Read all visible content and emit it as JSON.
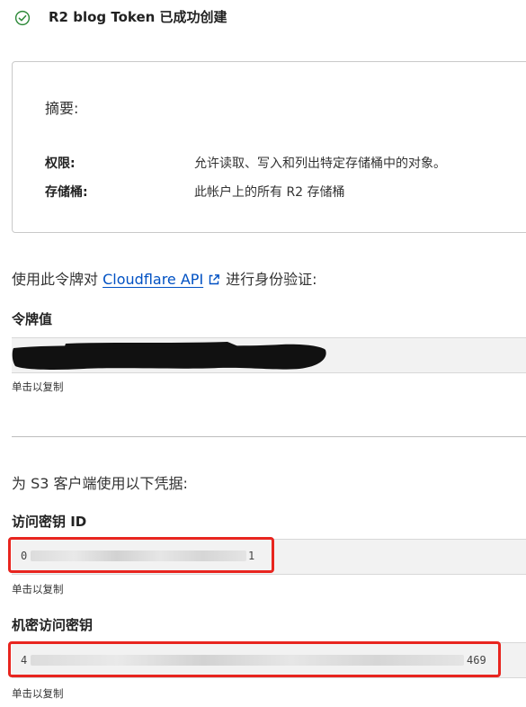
{
  "header": {
    "title": "R2 blog Token 已成功创建",
    "status_icon": "check-circle-icon",
    "status_color": "#2f8a3a"
  },
  "summary": {
    "heading": "摘要:",
    "rows": [
      {
        "label": "权限:",
        "value": "允许读取、写入和列出特定存储桶中的对象。"
      },
      {
        "label": "存储桶:",
        "value": "此帐户上的所有 R2 存储桶"
      }
    ]
  },
  "auth": {
    "prefix": "使用此令牌对",
    "link_text": "Cloudflare API",
    "suffix": "进行身份验证:",
    "link_color": "#0051c3"
  },
  "token": {
    "label": "令牌值",
    "value_state": "redacted",
    "copy_hint": "单击以复制"
  },
  "s3": {
    "intro": "为 S3 客户端使用以下凭据:",
    "access_key": {
      "label": "访问密钥 ID",
      "value_start": "0",
      "value_end": "1",
      "copy_hint": "单击以复制"
    },
    "secret_key": {
      "label": "机密访问密钥",
      "value_start": "4",
      "value_end": "469",
      "copy_hint": "单击以复制"
    }
  },
  "annotation_color": "#e8251f"
}
